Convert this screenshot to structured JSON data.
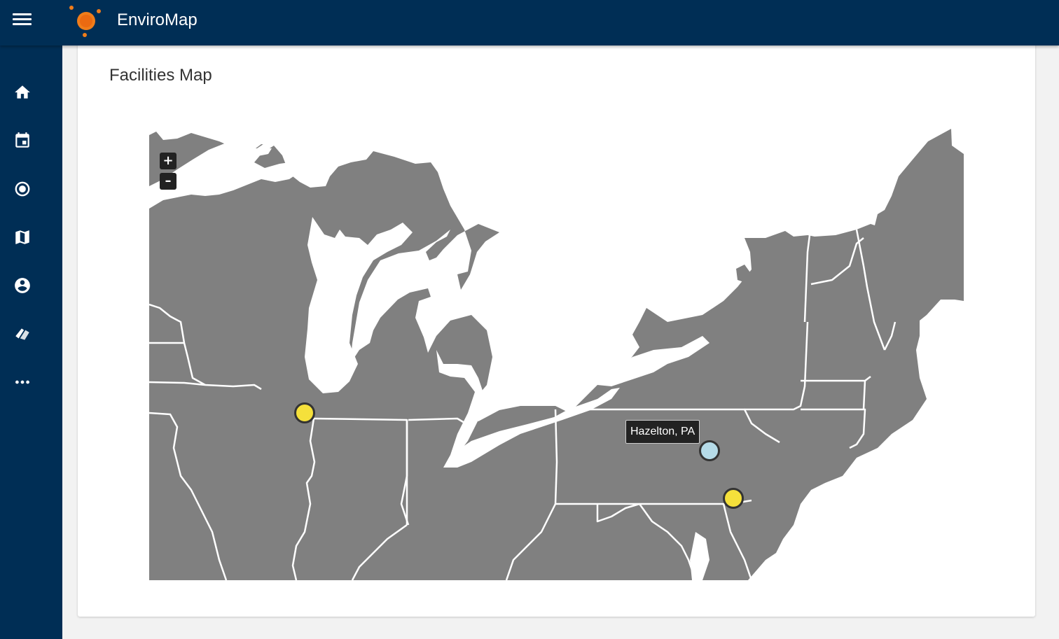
{
  "app": {
    "title": "EnviroMap",
    "colors": {
      "brand": "#002e55",
      "logo": "#f07d1a"
    }
  },
  "sidebar": {
    "items": [
      {
        "name": "home",
        "icon": "home-icon"
      },
      {
        "name": "calendar",
        "icon": "calendar-icon"
      },
      {
        "name": "target",
        "icon": "target-icon"
      },
      {
        "name": "map",
        "icon": "map-icon"
      },
      {
        "name": "account",
        "icon": "account-icon"
      },
      {
        "name": "tags",
        "icon": "tags-icon"
      },
      {
        "name": "more",
        "icon": "more-icon"
      }
    ]
  },
  "card": {
    "title": "Facilities Map"
  },
  "map": {
    "zoom_in_label": "+",
    "zoom_out_label": "–",
    "tooltip": "Hazelton, PA",
    "markers": [
      {
        "name": "facility-chicago",
        "status": "yellow",
        "color": "#f5e03b"
      },
      {
        "name": "facility-hazelton",
        "status": "light-blue",
        "color": "#b5dbe8"
      },
      {
        "name": "facility-wilmington",
        "status": "yellow",
        "color": "#f5e03b"
      }
    ],
    "land_color": "#808080",
    "border_color": "#ffffff"
  }
}
